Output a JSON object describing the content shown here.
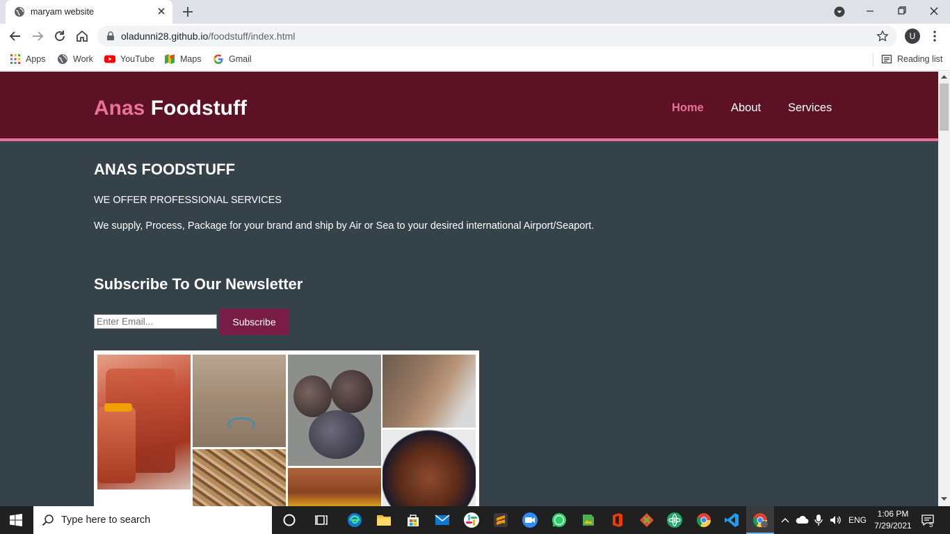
{
  "browser": {
    "tab_title": "maryam website",
    "url_domain": "oladunni28.github.io",
    "url_path": "/foodstuff/index.html",
    "profile_initial": "U",
    "bookmarks": [
      "Apps",
      "Work",
      "YouTube",
      "Maps",
      "Gmail"
    ],
    "reading_list": "Reading list"
  },
  "site": {
    "brand_accent": "Anas",
    "brand_rest": "Foodstuff",
    "nav": [
      "Home",
      "About",
      "Services"
    ],
    "heading": "ANAS FOODSTUFF",
    "tagline": "WE OFFER PROFESSIONAL SERVICES",
    "description": "We supply, Process, Package for your brand and ship by Air or Sea to your desired international Airport/Seaport.",
    "newsletter_heading": "Subscribe To Our Newsletter",
    "email_placeholder": "Enter Email...",
    "subscribe_label": "Subscribe",
    "colors": {
      "header": "#5d1124",
      "accent": "#e8739a",
      "body": "#35424a",
      "button": "#7a1d46"
    }
  },
  "taskbar": {
    "search_placeholder": "Type here to search",
    "language": "ENG",
    "time": "1:06 PM",
    "date": "7/29/2021",
    "notification_count": "5"
  }
}
